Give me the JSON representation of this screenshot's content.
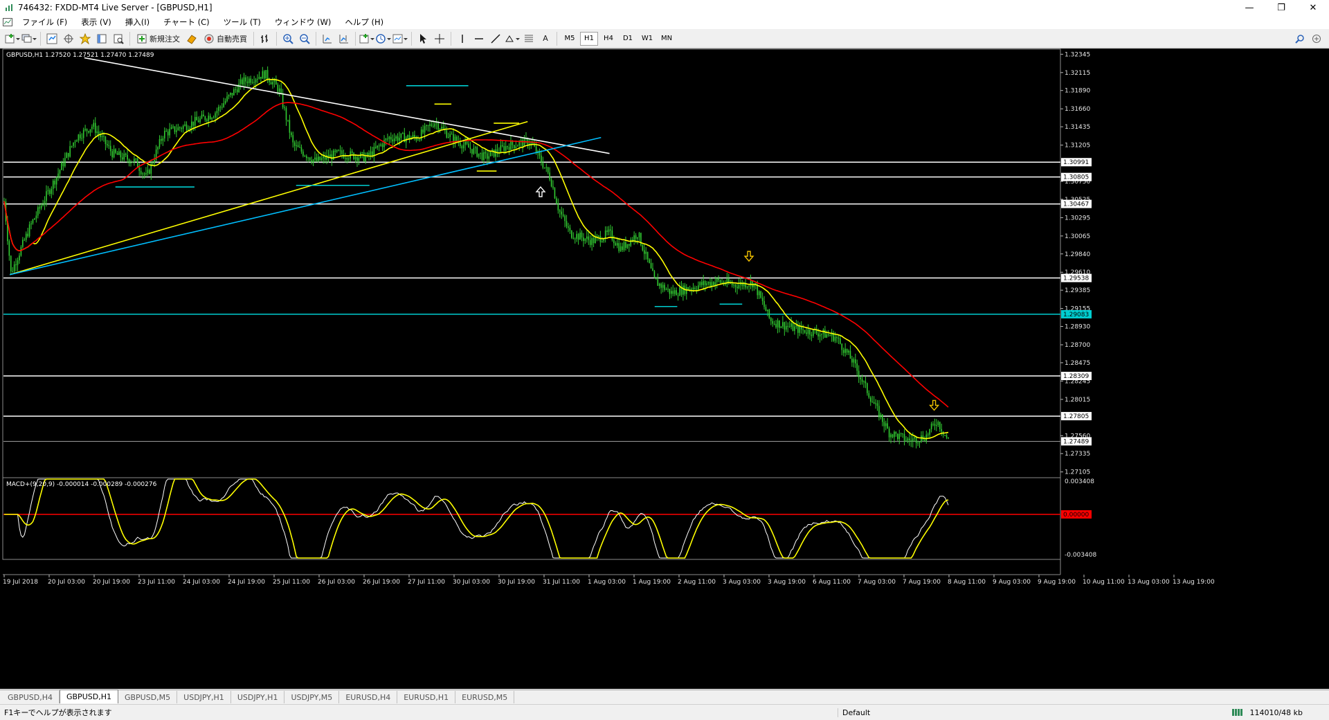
{
  "window": {
    "title": "746432: FXDD-MT4 Live Server - [GBPUSD,H1]",
    "minimize": "—",
    "restore": "❐",
    "close": "✕"
  },
  "menu": [
    "ファイル (F)",
    "表示 (V)",
    "挿入(I)",
    "チャート (C)",
    "ツール (T)",
    "ウィンドウ (W)",
    "ヘルプ (H)"
  ],
  "toolbar": {
    "new_order": "新規注文",
    "auto_trading": "自動売買",
    "text_tool": "A",
    "timeframes": [
      "M5",
      "H1",
      "H4",
      "D1",
      "W1",
      "MN"
    ],
    "active_timeframe": "H1"
  },
  "chart": {
    "info": "GBPUSD,H1  1.27520 1.27521 1.27470 1.27489",
    "current_price": "1.27489",
    "price_labels": [
      "1.32345",
      "1.32115",
      "1.31890",
      "1.31660",
      "1.31435",
      "1.31205",
      "1.30750",
      "1.30525",
      "1.30295",
      "1.30065",
      "1.29840",
      "1.29610",
      "1.29385",
      "1.29155",
      "1.28930",
      "1.28700",
      "1.28475",
      "1.28245",
      "1.28015",
      "1.27560",
      "1.27335",
      "1.27105"
    ],
    "hline_labels": [
      "1.30991",
      "1.30805",
      "1.30467",
      "1.29538",
      "1.29083",
      "1.28309",
      "1.27805"
    ],
    "time_labels": [
      "19 Jul 2018",
      "20 Jul 03:00",
      "20 Jul 19:00",
      "23 Jul 11:00",
      "24 Jul 03:00",
      "24 Jul 19:00",
      "25 Jul 11:00",
      "26 Jul 03:00",
      "26 Jul 19:00",
      "27 Jul 11:00",
      "30 Jul 03:00",
      "30 Jul 19:00",
      "31 Jul 11:00",
      "1 Aug 03:00",
      "1 Aug 19:00",
      "2 Aug 11:00",
      "3 Aug 03:00",
      "3 Aug 19:00",
      "6 Aug 11:00",
      "7 Aug 03:00",
      "7 Aug 19:00",
      "8 Aug 11:00",
      "9 Aug 03:00",
      "9 Aug 19:00",
      "10 Aug 11:00",
      "13 Aug 03:00",
      "13 Aug 19:00"
    ],
    "macd": {
      "info": "MACD+(9,20,9) -0.000014 -0.000289 -0.000276",
      "labels": [
        "0.003408",
        "0.00000",
        "-0.003408"
      ]
    },
    "colors": {
      "candle": "#32cd32",
      "ma_fast": "#ffff00",
      "ma_slow": "#ff0000",
      "level": "#ffffff",
      "level_cyan": "#00ced1",
      "trend_white": "#ffffff",
      "trend_yellow": "#ffff00",
      "trend_cyan": "#00bfff",
      "macd_signal": "#ffff00",
      "macd_zero": "#ff0000"
    }
  },
  "tabs": [
    "GBPUSD,H4",
    "GBPUSD,H1",
    "GBPUSD,M5",
    "USDJPY,H1",
    "USDJPY,H1",
    "USDJPY,M5",
    "EURUSD,H4",
    "EURUSD,H1",
    "EURUSD,M5"
  ],
  "active_tab": 1,
  "status": {
    "help": "F1キーでヘルプが表示されます",
    "profile": "Default",
    "traffic": "114010/48 kb"
  }
}
